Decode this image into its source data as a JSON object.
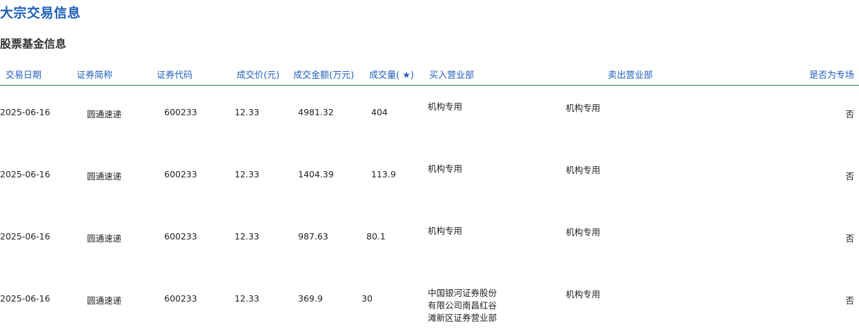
{
  "page": {
    "title": "大宗交易信息",
    "section_title": "股票基金信息"
  },
  "table": {
    "headers": {
      "date": "交易日期",
      "name": "证券简称",
      "code": "证券代码",
      "price": "成交价(元)",
      "amount": "成交金额(万元)",
      "volume": "成交量( ★)",
      "buyer": "买入营业部",
      "seller": "卖出营业部",
      "special": "是否为专场"
    },
    "rows": [
      {
        "date": "2025-06-16",
        "name": "圆通速递",
        "code": "600233",
        "price": "12.33",
        "amount": "4981.32",
        "volume": "404",
        "buyer": "机构专用",
        "seller": "机构专用",
        "special": "否"
      },
      {
        "date": "2025-06-16",
        "name": "圆通速递",
        "code": "600233",
        "price": "12.33",
        "amount": "1404.39",
        "volume": "113.9",
        "buyer": "机构专用",
        "seller": "机构专用",
        "special": "否"
      },
      {
        "date": "2025-06-16",
        "name": "圆通速递",
        "code": "600233",
        "price": "12.33",
        "amount": "987.63",
        "volume": "80.1",
        "buyer": "机构专用",
        "seller": "机构专用",
        "special": "否"
      },
      {
        "date": "2025-06-16",
        "name": "圆通速递",
        "code": "600233",
        "price": "12.33",
        "amount": "369.9",
        "volume": "30",
        "buyer": "中国银河证券股份有限公司南昌红谷滩新区证券营业部",
        "seller": "机构专用",
        "special": "否"
      }
    ]
  }
}
